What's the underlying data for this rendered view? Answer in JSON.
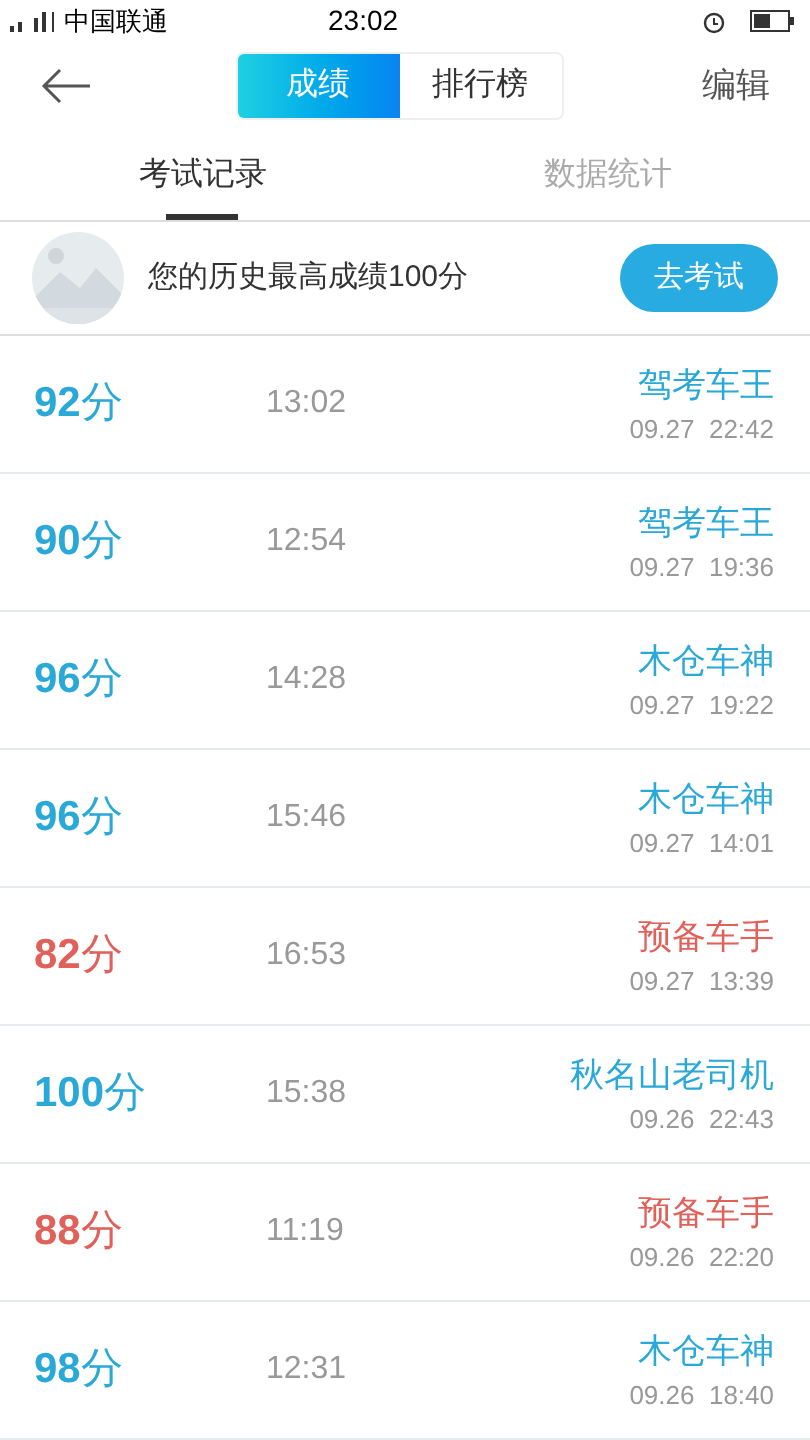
{
  "status_bar": {
    "carrier": "中国联通",
    "time": "23:02"
  },
  "nav": {
    "segments": [
      {
        "label": "成绩",
        "selected": true
      },
      {
        "label": "排行榜",
        "selected": false
      }
    ],
    "edit": "编辑"
  },
  "tabs": [
    {
      "label": "考试记录",
      "selected": true
    },
    {
      "label": "数据统计",
      "selected": false
    }
  ],
  "banner": {
    "text": "您的历史最高成绩100分",
    "button": "去考试"
  },
  "records": [
    {
      "score": "**92**分",
      "duration": "13:02",
      "title": "驾考车王",
      "date": "09.27  22:42",
      "color": "#2aa9d8"
    },
    {
      "score": "**90**分",
      "duration": "12:54",
      "title": "驾考车王",
      "date": "09.27  19:36",
      "color": "#2aa9d8"
    },
    {
      "score": "**96**分",
      "duration": "14:28",
      "title": "木仓车神",
      "date": "09.27  19:22",
      "color": "#2aa9d8"
    },
    {
      "score": "**96**分",
      "duration": "15:46",
      "title": "木仓车神",
      "date": "09.27  14:01",
      "color": "#2aa9d8"
    },
    {
      "score": "**82**分",
      "duration": "16:53",
      "title": "预备车手",
      "date": "09.27  13:39",
      "color": "#e0605a"
    },
    {
      "score": "**100**分",
      "duration": "15:38",
      "title": "秋名山老司机",
      "date": "09.26  22:43",
      "color": "#2aa9d8"
    },
    {
      "score": "**88**分",
      "duration": "11:19",
      "title": "预备车手",
      "date": "09.26  22:20",
      "color": "#e0605a"
    },
    {
      "score": "**98**分",
      "duration": "12:31",
      "title": "木仓车神",
      "date": "09.26  18:40",
      "color": "#2aa9d8"
    }
  ]
}
